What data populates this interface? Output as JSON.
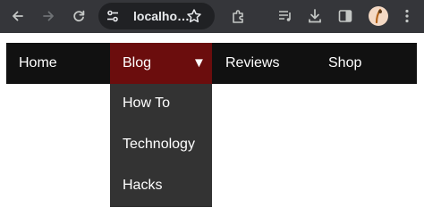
{
  "browser": {
    "url": "localho…",
    "icons": [
      "back-icon",
      "forward-icon",
      "reload-icon",
      "tune-icon",
      "bookmark-star-icon",
      "extensions-icon",
      "media-control-icon",
      "download-icon",
      "side-panel-icon",
      "profile-avatar",
      "more-menu-icon"
    ]
  },
  "navbar": {
    "home": "Home",
    "blog": "Blog",
    "blog_caret": "▼",
    "reviews": "Reviews",
    "shop": "Shop",
    "active_color": "#6b0d0d",
    "bar_color": "#111111"
  },
  "dropdown": {
    "items": [
      "How To",
      "Technology",
      "Hacks"
    ],
    "bg_color": "#333333"
  }
}
